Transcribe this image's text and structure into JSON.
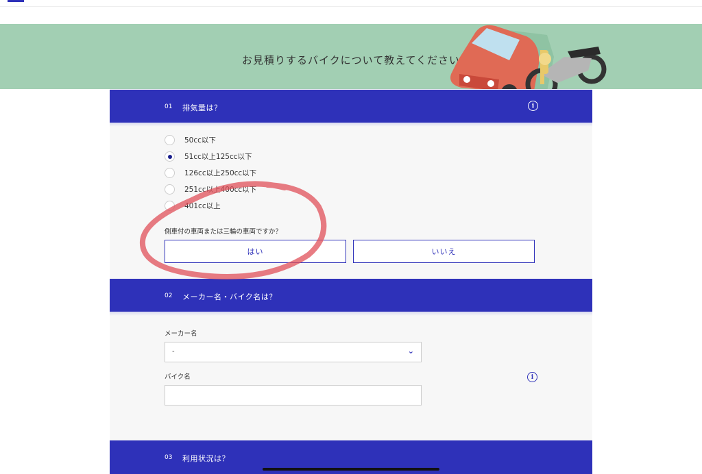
{
  "hero": {
    "title": "お見積りするバイクについて教えてください"
  },
  "sections": [
    {
      "num": "01",
      "title": "排気量は？",
      "icon": "info-icon"
    },
    {
      "num": "02",
      "title": "メーカー名・バイク名は？",
      "icon": "info-icon"
    },
    {
      "num": "03",
      "title": "利用状況は？"
    }
  ],
  "displacement": {
    "options": [
      "50cc以下",
      "51cc以上125cc以下",
      "126cc以上250cc以下",
      "251cc以上400cc以下",
      "401cc以上"
    ],
    "selected": "51cc以上125cc以下"
  },
  "sidecar": {
    "question": "側車付の車両または三輪の車両ですか？",
    "yes": "はい",
    "no": "いいえ"
  },
  "maker": {
    "label": "メーカー名",
    "value": "-"
  },
  "bike": {
    "label": "バイク名",
    "value": ""
  },
  "colors": {
    "accent": "#2e31b9",
    "hero_bg": "#a2cfb3",
    "annotation": "#e0505a"
  }
}
